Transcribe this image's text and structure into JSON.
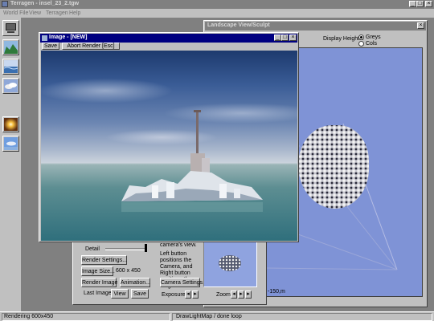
{
  "app": {
    "title": "Terragen - insel_23_2.tgw",
    "menu": [
      "World File",
      "View",
      "Terragen",
      "Help"
    ],
    "controls": {
      "minimize": "_",
      "maximize": "□",
      "close": "×"
    }
  },
  "toolbar": {
    "tools": [
      {
        "name": "rendering-control-tool"
      },
      {
        "name": "landscape-tool"
      },
      {
        "name": "water-tool"
      },
      {
        "name": "clouds-tool"
      },
      {
        "name": "sun-tool"
      },
      {
        "name": "atmosphere-tool"
      }
    ]
  },
  "image_window": {
    "title": "Image - [NEW]",
    "save_label": "Save",
    "abort_label": "Abort Render  [Esc]"
  },
  "landscape_window": {
    "title": "Landscape View/Sculpt",
    "display_heights_label": "Display Heights:",
    "option_greys": "Greys",
    "option_cols": "Cols",
    "coord_label": "-150,m"
  },
  "render_panel": {
    "detail_label": "Detail",
    "render_settings_label": "Render Settings...",
    "image_size_label": "Image Size...",
    "image_size_value": "600 x 450",
    "render_image_label": "Render Image",
    "animation_label": "Animation...",
    "last_image_label": "Last Image:",
    "view_label": "View",
    "save_label": "Save",
    "camera_text_1": "camera's view.",
    "camera_text_2": "Left button positions the Camera, and Right button positions the Target.",
    "camera_settings_label": "Camera Settings...",
    "exposure_label": "Exposure",
    "zoom_label": "Zoom"
  },
  "statusbar": {
    "left": "Rendering 600x450",
    "right": "DrawLightMap / done loop"
  },
  "colors": {
    "titlebar_active": "#000080",
    "titlebar_inactive": "#808080",
    "face": "#c0c0c0",
    "map_blue": "#7f93d6"
  }
}
